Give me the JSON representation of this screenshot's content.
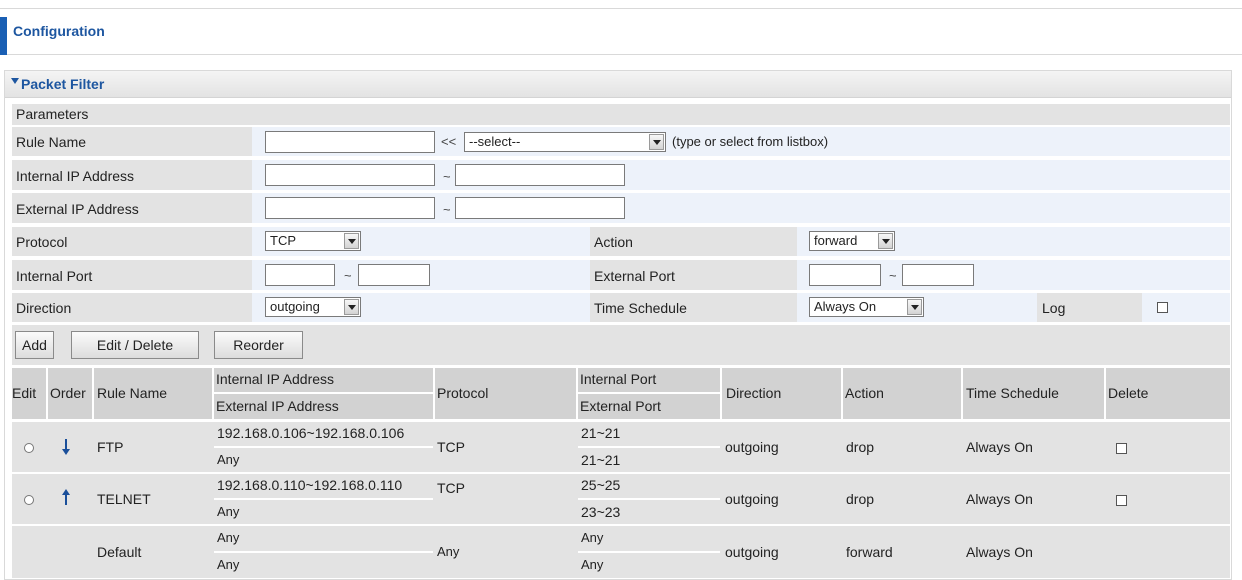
{
  "header": {
    "title": "Configuration"
  },
  "section": {
    "title": "Packet Filter",
    "subtitle": "Parameters"
  },
  "form": {
    "rule_name": {
      "label": "Rule Name",
      "value": "",
      "separator": "<<",
      "select": "--select--",
      "hint": "(type or select from listbox)"
    },
    "internal_ip": {
      "label": "Internal IP Address",
      "from": "",
      "separator": "~",
      "to": ""
    },
    "external_ip": {
      "label": "External IP Address",
      "from": "",
      "separator": "~",
      "to": ""
    },
    "protocol": {
      "label": "Protocol",
      "value": "TCP"
    },
    "action": {
      "label": "Action",
      "value": "forward"
    },
    "internal_port": {
      "label": "Internal Port",
      "from": "",
      "separator": "~",
      "to": ""
    },
    "external_port": {
      "label": "External Port",
      "from": "",
      "separator": "~",
      "to": ""
    },
    "direction": {
      "label": "Direction",
      "value": "outgoing"
    },
    "time_schedule": {
      "label": "Time Schedule",
      "value": "Always On"
    },
    "log": {
      "label": "Log",
      "checked": false
    }
  },
  "buttons": {
    "add": "Add",
    "edit_delete": "Edit / Delete",
    "reorder": "Reorder"
  },
  "table": {
    "headers": {
      "edit": "Edit",
      "order": "Order",
      "rule_name": "Rule Name",
      "internal_ip": "Internal IP Address",
      "external_ip": "External IP Address",
      "protocol": "Protocol",
      "internal_port": "Internal Port",
      "external_port": "External Port",
      "direction": "Direction",
      "action": "Action",
      "time_schedule": "Time Schedule",
      "delete": "Delete"
    },
    "rows": [
      {
        "rule_name": "FTP",
        "order_icon": "arrow-down-icon",
        "internal_ip": "192.168.0.106~192.168.0.106",
        "external_ip": "Any",
        "protocol": "TCP",
        "internal_port": "21~21",
        "external_port": "21~21",
        "direction": "outgoing",
        "action": "drop",
        "time_schedule": "Always On"
      },
      {
        "rule_name": "TELNET",
        "order_icon": "arrow-up-icon",
        "internal_ip": "192.168.0.110~192.168.0.110",
        "external_ip": "Any",
        "protocol": "TCP",
        "internal_port": "25~25",
        "external_port": "23~23",
        "direction": "outgoing",
        "action": "drop",
        "time_schedule": "Always On"
      },
      {
        "rule_name": "Default",
        "internal_ip": "Any",
        "external_ip": "Any",
        "protocol": "Any",
        "internal_port": "Any",
        "external_port": "Any",
        "direction": "outgoing",
        "action": "forward",
        "time_schedule": "Always On"
      }
    ]
  },
  "colors": {
    "accent": "#1a5fb4",
    "title_text": "#1d56a0",
    "param_row_bg": "#edf2fa",
    "gray_row_bg": "#e3e3e3",
    "table_header_bg": "#d2d2d2",
    "arrow": "#1a4f9a"
  }
}
